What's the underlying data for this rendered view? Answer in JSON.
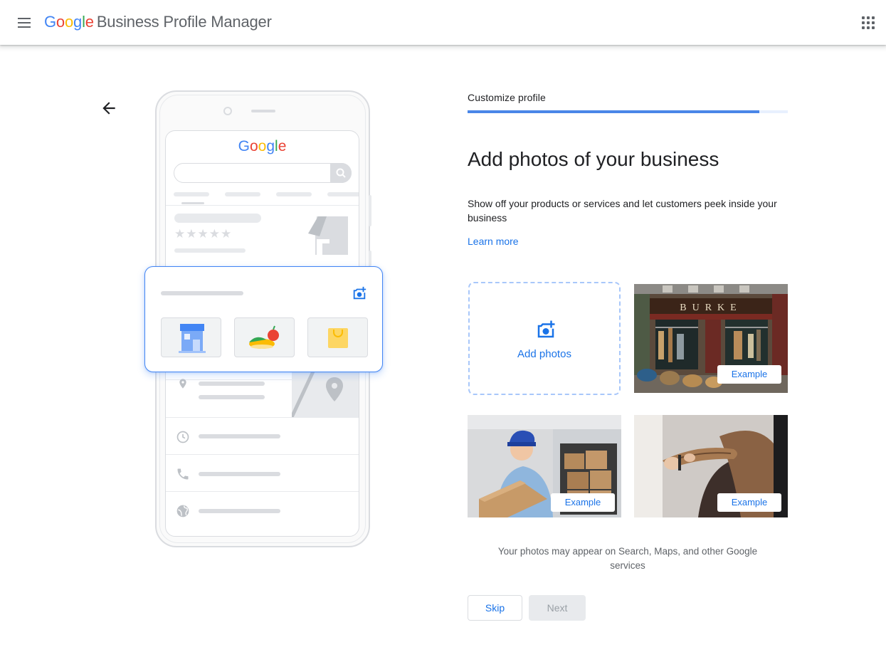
{
  "header": {
    "logo_letters": [
      {
        "ch": "G",
        "color": "#4285F4"
      },
      {
        "ch": "o",
        "color": "#EA4335"
      },
      {
        "ch": "o",
        "color": "#FBBC05"
      },
      {
        "ch": "g",
        "color": "#4285F4"
      },
      {
        "ch": "l",
        "color": "#34A853"
      },
      {
        "ch": "e",
        "color": "#EA4335"
      }
    ],
    "product_name": "Business Profile Manager",
    "menu_icon": "hamburger-menu-icon",
    "apps_icon": "apps-grid-icon"
  },
  "illustration": {
    "screen_logo": "Google"
  },
  "main": {
    "back_icon": "arrow-back-icon",
    "step_label": "Customize profile",
    "progress": 0.91,
    "heading": "Add photos of your business",
    "description": "Show off your products or services and let customers peek inside your business",
    "learn_more": "Learn more",
    "add_photos_label": "Add photos",
    "example_photos": [
      {
        "badge": "Example",
        "subject": "storefront"
      },
      {
        "badge": "Example",
        "subject": "delivery-worker"
      },
      {
        "badge": "Example",
        "subject": "hair-stylist"
      }
    ],
    "footer_note": "Your photos may appear on Search, Maps, and other Google services",
    "skip_label": "Skip",
    "next_label": "Next"
  },
  "colors": {
    "accent": "#1a73e8",
    "progress": "#4a86e8",
    "dashed_border": "#a8c7fa"
  }
}
